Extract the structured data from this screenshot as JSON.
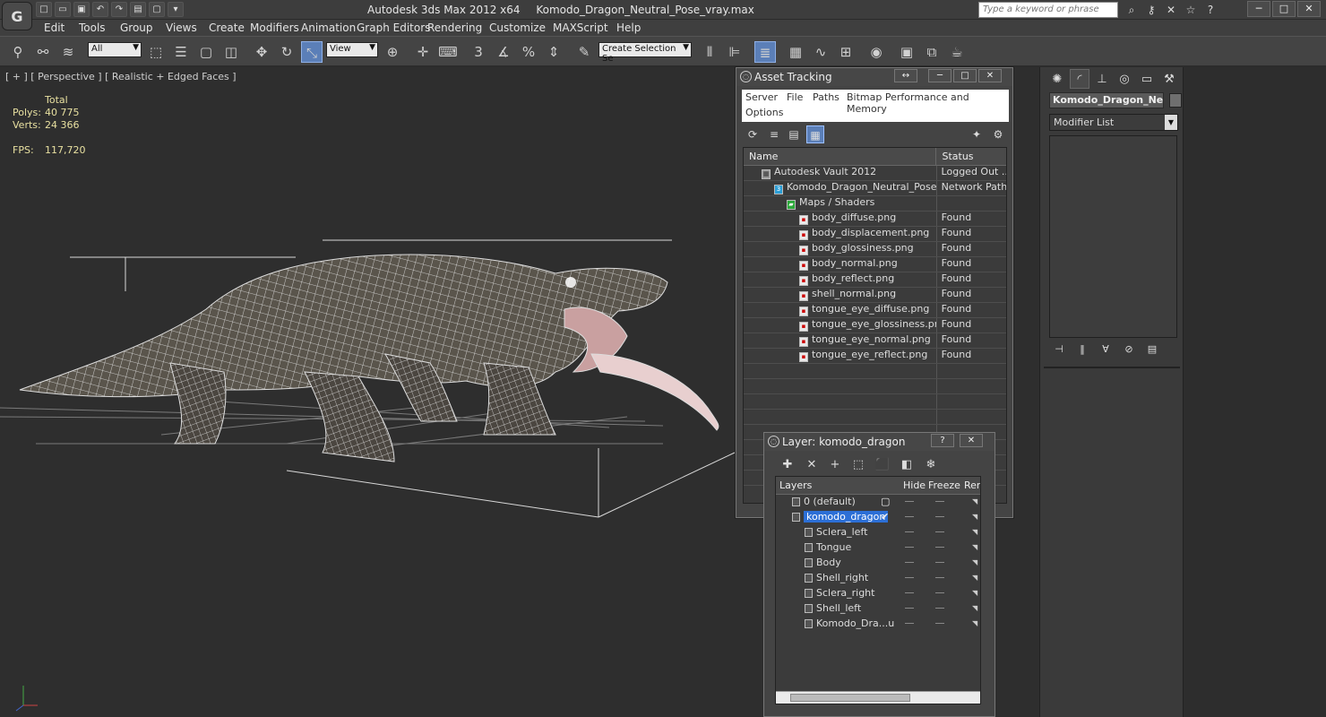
{
  "titlebar": {
    "app": "Autodesk 3ds Max  2012 x64",
    "file": "Komodo_Dragon_Neutral_Pose_vray.max",
    "search_placeholder": "Type a keyword or phrase"
  },
  "menu": [
    "Edit",
    "Tools",
    "Group",
    "Views",
    "Create",
    "Modifiers",
    "Animation",
    "Graph Editors",
    "Rendering",
    "Customize",
    "MAXScript",
    "Help"
  ],
  "toolbar": {
    "selection_filter": "All",
    "ref_coord": "View",
    "named_selection": "Create Selection Se",
    "snaps_label": "3",
    "percent_label": "%"
  },
  "viewport": {
    "label": "[ + ] [ Perspective ] [ Realistic + Edged Faces ]",
    "stats_header": "Total",
    "polys_label": "Polys:",
    "polys": "40 775",
    "verts_label": "Verts:",
    "verts": "24 366",
    "fps_label": "FPS:",
    "fps": "117,720"
  },
  "command_panel": {
    "object_name": "Komodo_Dragon_Neutral",
    "modifier_list": "Modifier List"
  },
  "asset_tracking": {
    "title": "Asset Tracking",
    "menu": [
      "Server",
      "File",
      "Paths",
      "Bitmap Performance and Memory",
      "Options"
    ],
    "columns": [
      "Name",
      "Status"
    ],
    "rows": [
      {
        "name": "Autodesk Vault 2012",
        "status": "Logged Out ...",
        "indent": 1,
        "icon": "vault"
      },
      {
        "name": "Komodo_Dragon_Neutral_Pose_v...",
        "status": "Network Path",
        "indent": 2,
        "icon": "max"
      },
      {
        "name": "Maps / Shaders",
        "status": "",
        "indent": 3,
        "icon": "maps"
      },
      {
        "name": "body_diffuse.png",
        "status": "Found",
        "indent": 4,
        "icon": "file"
      },
      {
        "name": "body_displacement.png",
        "status": "Found",
        "indent": 4,
        "icon": "file"
      },
      {
        "name": "body_glossiness.png",
        "status": "Found",
        "indent": 4,
        "icon": "file"
      },
      {
        "name": "body_normal.png",
        "status": "Found",
        "indent": 4,
        "icon": "file"
      },
      {
        "name": "body_reflect.png",
        "status": "Found",
        "indent": 4,
        "icon": "file"
      },
      {
        "name": "shell_normal.png",
        "status": "Found",
        "indent": 4,
        "icon": "file"
      },
      {
        "name": "tongue_eye_diffuse.png",
        "status": "Found",
        "indent": 4,
        "icon": "file"
      },
      {
        "name": "tongue_eye_glossiness.png",
        "status": "Found",
        "indent": 4,
        "icon": "file"
      },
      {
        "name": "tongue_eye_normal.png",
        "status": "Found",
        "indent": 4,
        "icon": "file"
      },
      {
        "name": "tongue_eye_reflect.png",
        "status": "Found",
        "indent": 4,
        "icon": "file"
      }
    ]
  },
  "layer_dialog": {
    "title": "Layer: komodo_dragon",
    "help": "?",
    "columns": [
      "Layers",
      "Hide",
      "Freeze",
      "Ren"
    ],
    "rows": [
      {
        "name": "0 (default)",
        "level": 0,
        "selected": false,
        "current": false
      },
      {
        "name": "komodo_dragon",
        "level": 0,
        "selected": true,
        "current": true
      },
      {
        "name": "Sclera_left",
        "level": 1,
        "selected": false,
        "current": false
      },
      {
        "name": "Tongue",
        "level": 1,
        "selected": false,
        "current": false
      },
      {
        "name": "Body",
        "level": 1,
        "selected": false,
        "current": false
      },
      {
        "name": "Shell_right",
        "level": 1,
        "selected": false,
        "current": false
      },
      {
        "name": "Sclera_right",
        "level": 1,
        "selected": false,
        "current": false
      },
      {
        "name": "Shell_left",
        "level": 1,
        "selected": false,
        "current": false
      },
      {
        "name": "Komodo_Dra...u",
        "level": 1,
        "selected": false,
        "current": false
      }
    ]
  },
  "colors": {
    "selection_blue": "#2c6fd6",
    "stats_yellow": "#e8e0a0",
    "wire_white": "#e6e6e6"
  }
}
